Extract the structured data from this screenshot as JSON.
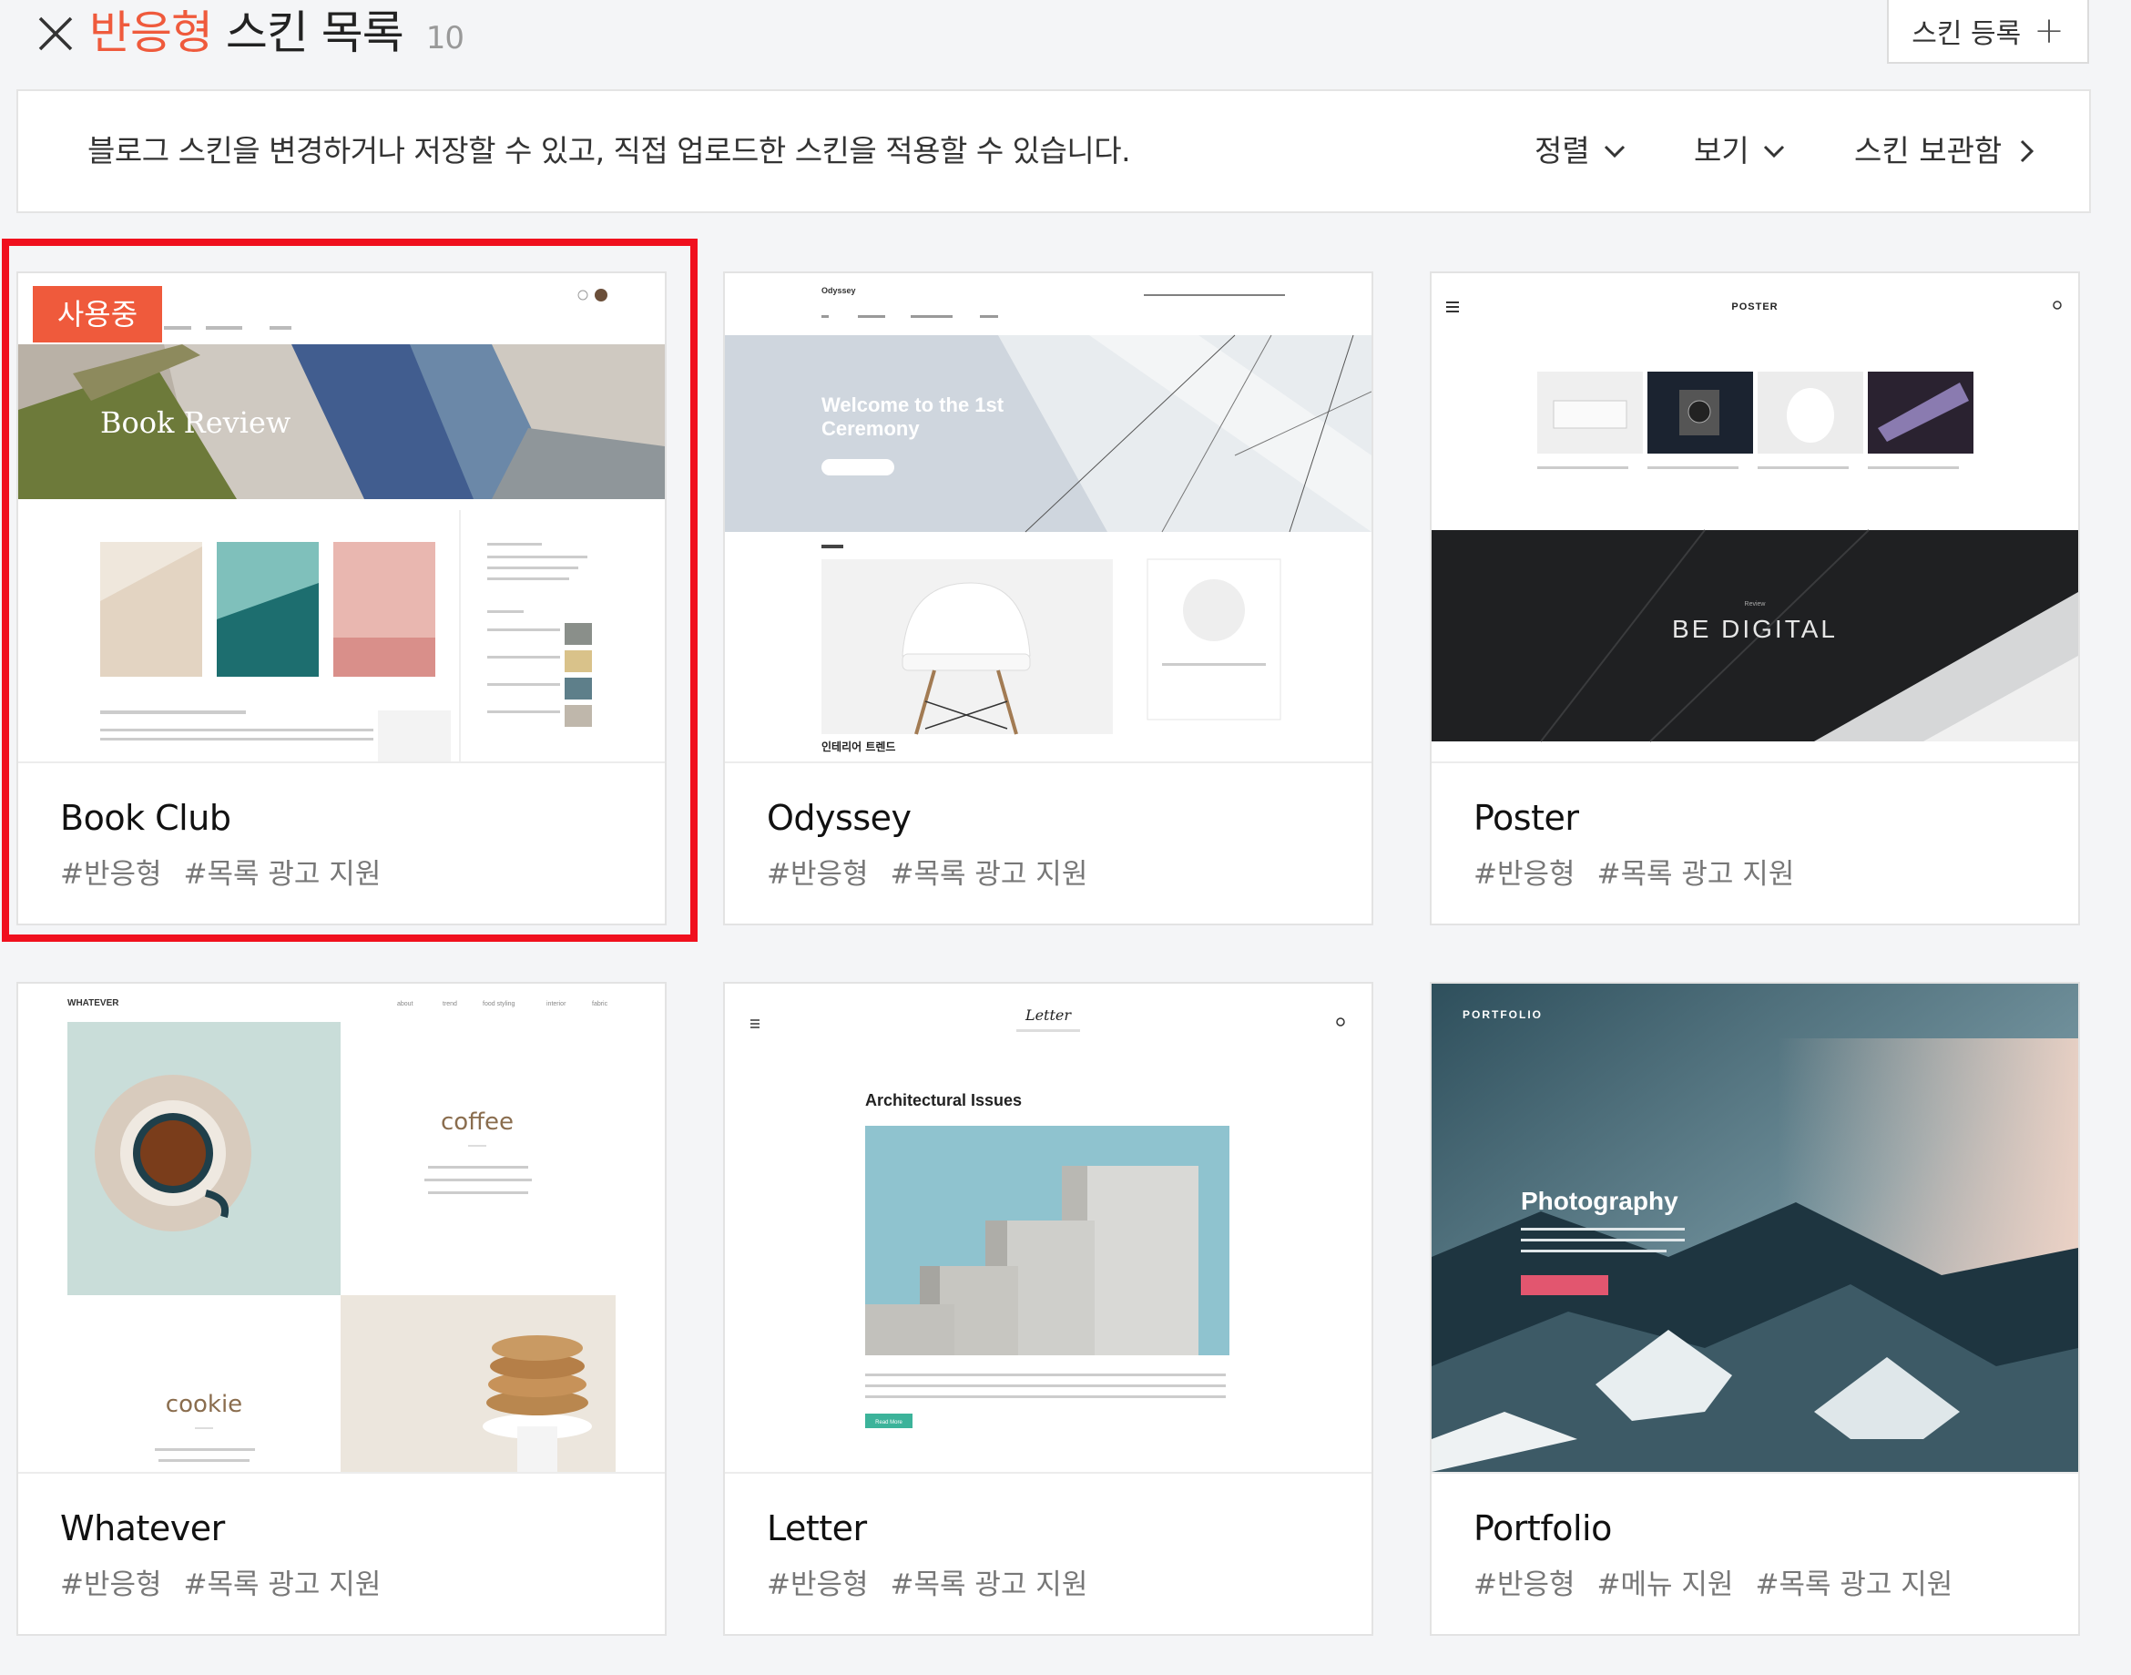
{
  "header": {
    "title_accent": "반응형",
    "title_rest": "스킨 목록",
    "count": "10",
    "register_label": "스킨 등록"
  },
  "info": {
    "description": "블로그 스킨을 변경하거나 저장할 수 있고, 직접 업로드한 스킨을 적용할 수 있습니다.",
    "sort_label": "정렬",
    "view_label": "보기",
    "storage_label": "스킨 보관함"
  },
  "in_use_badge": "사용중",
  "cards": [
    {
      "name": "Book Club",
      "tags": [
        "#반응형",
        "#목록 광고 지원"
      ],
      "selected": true
    },
    {
      "name": "Odyssey",
      "tags": [
        "#반응형",
        "#목록 광고 지원"
      ]
    },
    {
      "name": "Poster",
      "tags": [
        "#반응형",
        "#목록 광고 지원"
      ]
    },
    {
      "name": "Whatever",
      "tags": [
        "#반응형",
        "#목록 광고 지원"
      ]
    },
    {
      "name": "Letter",
      "tags": [
        "#반응형",
        "#목록 광고 지원"
      ]
    },
    {
      "name": "Portfolio",
      "tags": [
        "#반응형",
        "#메뉴 지원",
        "#목록 광고 지원"
      ]
    }
  ],
  "previews": {
    "bookclub": {
      "hero_text": "Book Review"
    },
    "odyssey": {
      "brand": "Odyssey",
      "hero_line1": "Welcome to the 1st",
      "hero_line2": "Ceremony",
      "section_title": "인테리어 트렌드"
    },
    "poster": {
      "brand": "POSTER",
      "banner_small": "Review",
      "banner_text": "BE DIGITAL"
    },
    "whatever": {
      "brand": "WHATEVER",
      "nav": [
        "about",
        "trend",
        "food styling",
        "interior",
        "fabric"
      ],
      "word1": "coffee",
      "word2": "cookie"
    },
    "letter": {
      "brand": "Letter",
      "post_title": "Architectural Issues",
      "button": "Read More"
    },
    "portfolio": {
      "brand": "PORTFOLIO",
      "hero_text": "Photography"
    }
  },
  "colors": {
    "accent": "#ef5a3c",
    "selection_frame": "#f0101e",
    "background": "#f4f5f7"
  }
}
